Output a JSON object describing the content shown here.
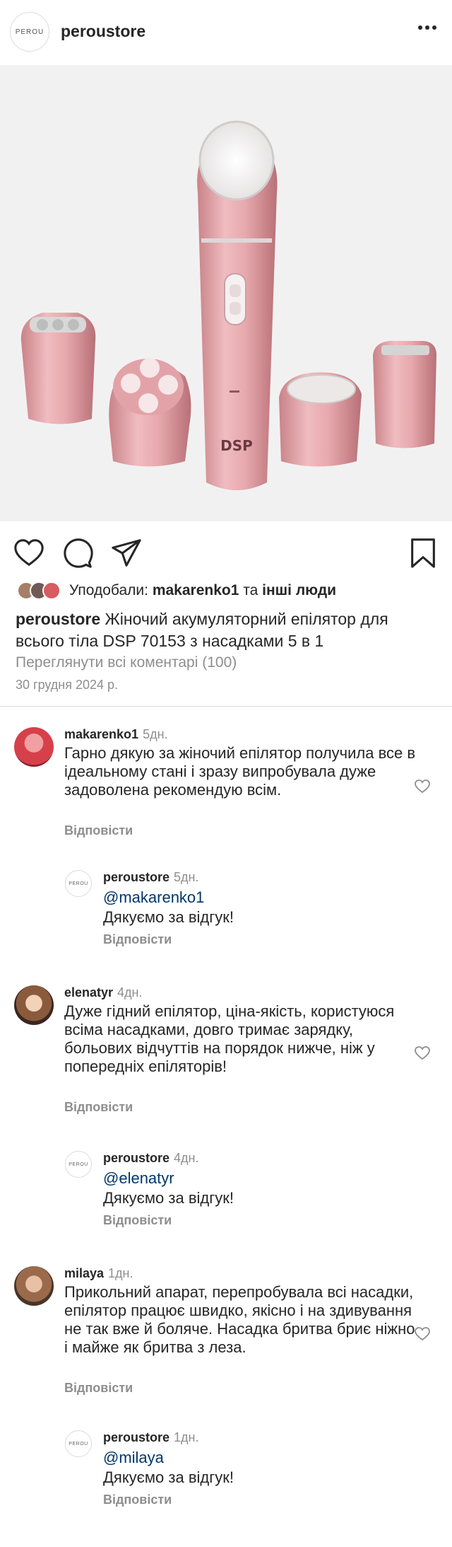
{
  "header": {
    "logo_text": "PEROU",
    "username": "peroustore"
  },
  "product_image": {
    "brand_mark": "DSP",
    "colors": {
      "background": "#f2f1f1",
      "body": "#e7a9ad",
      "body_shade": "#c98388"
    }
  },
  "actions": [
    "heart-icon",
    "comment-icon",
    "share-icon",
    "bookmark-icon"
  ],
  "likes": {
    "prefix": "Уподобали:",
    "user": "makarenko1",
    "joiner": "та",
    "others": "інші люди"
  },
  "caption": {
    "user": "peroustore",
    "text": "Жіночий акумуляторний епілятор для всього тіла DSP 70153 з насадками 5 в 1"
  },
  "view_all_comments": "Переглянути всі коментарі (100)",
  "post_date": "30 грудня 2024 р.",
  "reply_label": "Відповісти",
  "comments": [
    {
      "user": "makarenko1",
      "time": "5дн.",
      "text": "Гарно дякую за жіночий епілятор получила все в ідеальному стані і зразу випробувала дуже задоволена рекомендую всім.",
      "reply": {
        "user": "peroustore",
        "time": "5дн.",
        "mention": "@makarenko1",
        "text": "Дякуємо за відгук!"
      }
    },
    {
      "user": "elenatyr",
      "time": "4дн.",
      "text": "Дуже гідний епілятор, ціна-якість, користуюся всіма насадками, довго тримає зарядку, больових відчуттів на порядок нижче, ніж у попередніх епіляторів!",
      "reply": {
        "user": "peroustore",
        "time": "4дн.",
        "mention": "@elenatyr",
        "text": "Дякуємо за відгук!"
      }
    },
    {
      "user": "milaya",
      "time": "1дн.",
      "text": "Прикольний апарат, перепробувала всі насадки, епілятор працює швидко, якісно і на здивування не так вже й боляче. Насадка бритва бриє ніжно і майже як бритва з леза.",
      "reply": {
        "user": "peroustore",
        "time": "1дн.",
        "mention": "@milaya",
        "text": "Дякуємо за відгук!"
      }
    }
  ]
}
